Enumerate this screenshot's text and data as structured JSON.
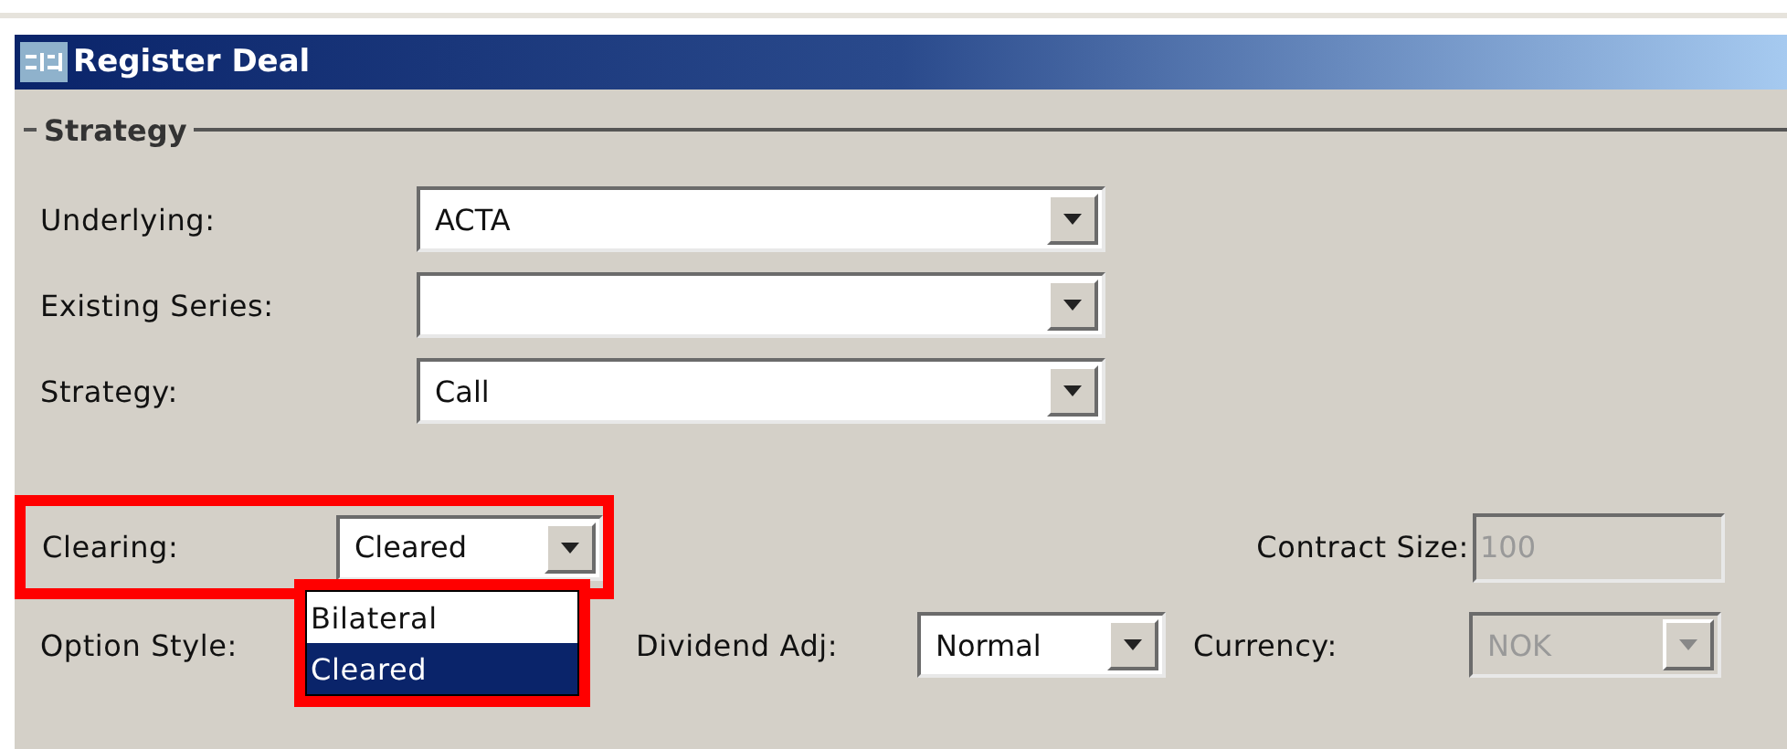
{
  "window": {
    "title": "Register Deal"
  },
  "group": {
    "label": "Strategy"
  },
  "fields": [
    {
      "label": "Underlying:",
      "value": "ACTA"
    },
    {
      "label": "Existing Series:"
    },
    {
      "label": "Strategy:",
      "value": "Call"
    }
  ],
  "clearing": {
    "label": "Clearing:",
    "value": "Cleared",
    "highlighted": true
  },
  "contract_size": {
    "label": "Contract Size:",
    "value": "100",
    "disabled": true
  },
  "option_style": {
    "label": "Option Style:",
    "list_highlighted": true,
    "options": [
      {
        "label": "Bilateral",
        "selected": false
      },
      {
        "label": "Cleared",
        "selected": true
      }
    ]
  },
  "dividend_adj": {
    "label": "Dividend Adj:",
    "value": "Normal"
  },
  "currency": {
    "label": "Currency:",
    "value": "NOK",
    "disabled": true
  }
}
